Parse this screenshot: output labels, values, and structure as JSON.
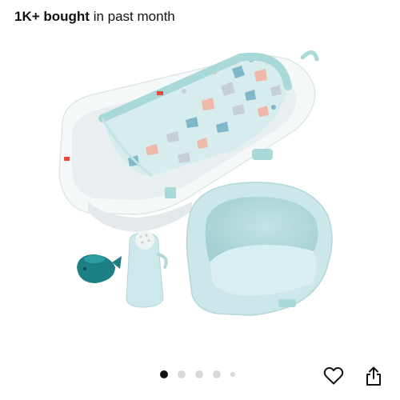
{
  "header": {
    "bought_count": "1K+ bought",
    "bought_suffix": " in past month"
  },
  "product": {
    "image_alt": "Infant bath tub with terrazzo sling, toddler seat, rinse cup and whale squirt toy"
  },
  "carousel": {
    "dots": [
      "active",
      "inactive",
      "inactive",
      "inactive",
      "small"
    ]
  },
  "actions": {
    "wishlist_icon": "heart-outline-icon",
    "share_icon": "share-upload-icon"
  },
  "colors": {
    "aqua_light": "#d9eff0",
    "aqua_mid": "#a9d8d8",
    "teal_toy": "#1d7f84",
    "tub_white": "#f7f9f9",
    "brand_red": "#e84b3a"
  }
}
